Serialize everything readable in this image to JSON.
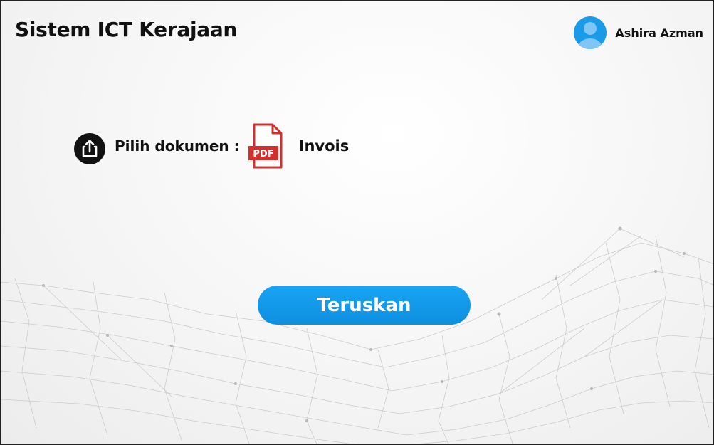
{
  "header": {
    "title": "Sistem ICT Kerajaan",
    "user": {
      "name": "Ashira Azman",
      "avatar_icon": "user-avatar-icon",
      "avatar_color": "#1a9be8"
    }
  },
  "document": {
    "pick_label": "Pilih dokumen :",
    "upload_icon": "upload-share-icon",
    "file_icon": "pdf-file-icon",
    "file_badge": "PDF",
    "file_name": "Invois"
  },
  "actions": {
    "continue_label": "Teruskan"
  },
  "colors": {
    "primary": "#1a9be8",
    "pdf_red": "#d32f2f",
    "text": "#111111"
  }
}
